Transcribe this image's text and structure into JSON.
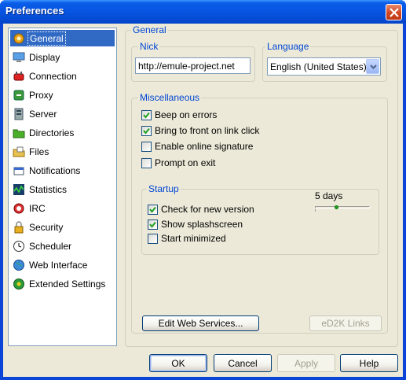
{
  "window": {
    "title": "Preferences"
  },
  "nav": {
    "items": [
      {
        "label": "General",
        "icon": "gear-icon",
        "selected": true
      },
      {
        "label": "Display",
        "icon": "monitor-icon"
      },
      {
        "label": "Connection",
        "icon": "plug-icon"
      },
      {
        "label": "Proxy",
        "icon": "proxy-icon"
      },
      {
        "label": "Server",
        "icon": "server-icon"
      },
      {
        "label": "Directories",
        "icon": "folder-icon"
      },
      {
        "label": "Files",
        "icon": "files-icon"
      },
      {
        "label": "Notifications",
        "icon": "notification-icon"
      },
      {
        "label": "Statistics",
        "icon": "statistics-icon"
      },
      {
        "label": "IRC",
        "icon": "irc-icon"
      },
      {
        "label": "Security",
        "icon": "lock-icon"
      },
      {
        "label": "Scheduler",
        "icon": "clock-icon"
      },
      {
        "label": "Web Interface",
        "icon": "globe-icon"
      },
      {
        "label": "Extended Settings",
        "icon": "extended-settings-icon"
      }
    ]
  },
  "general": {
    "group_label": "General",
    "nick": {
      "label": "Nick",
      "value": "http://emule-project.net"
    },
    "language": {
      "label": "Language",
      "selected": "English (United States)"
    },
    "misc": {
      "label": "Miscellaneous",
      "options": [
        {
          "label": "Beep on errors",
          "checked": true
        },
        {
          "label": "Bring to front on link click",
          "checked": true
        },
        {
          "label": "Enable online signature",
          "checked": false
        },
        {
          "label": "Prompt on exit",
          "checked": false
        }
      ]
    },
    "startup": {
      "label": "Startup",
      "days_label": "5 days",
      "days_level": 0.4,
      "options": [
        {
          "label": "Check for new version",
          "checked": true
        },
        {
          "label": "Show splashscreen",
          "checked": true
        },
        {
          "label": "Start minimized",
          "checked": false
        }
      ]
    },
    "buttons": {
      "edit_web_services": "Edit Web Services...",
      "ed2k_links": "eD2K Links"
    }
  },
  "dialog_buttons": {
    "ok": "OK",
    "cancel": "Cancel",
    "apply": "Apply",
    "help": "Help"
  },
  "colors": {
    "titlebar": "#0a5ee8",
    "selection": "#316ac5",
    "group_label": "#0046d5",
    "face": "#ece9d8"
  }
}
